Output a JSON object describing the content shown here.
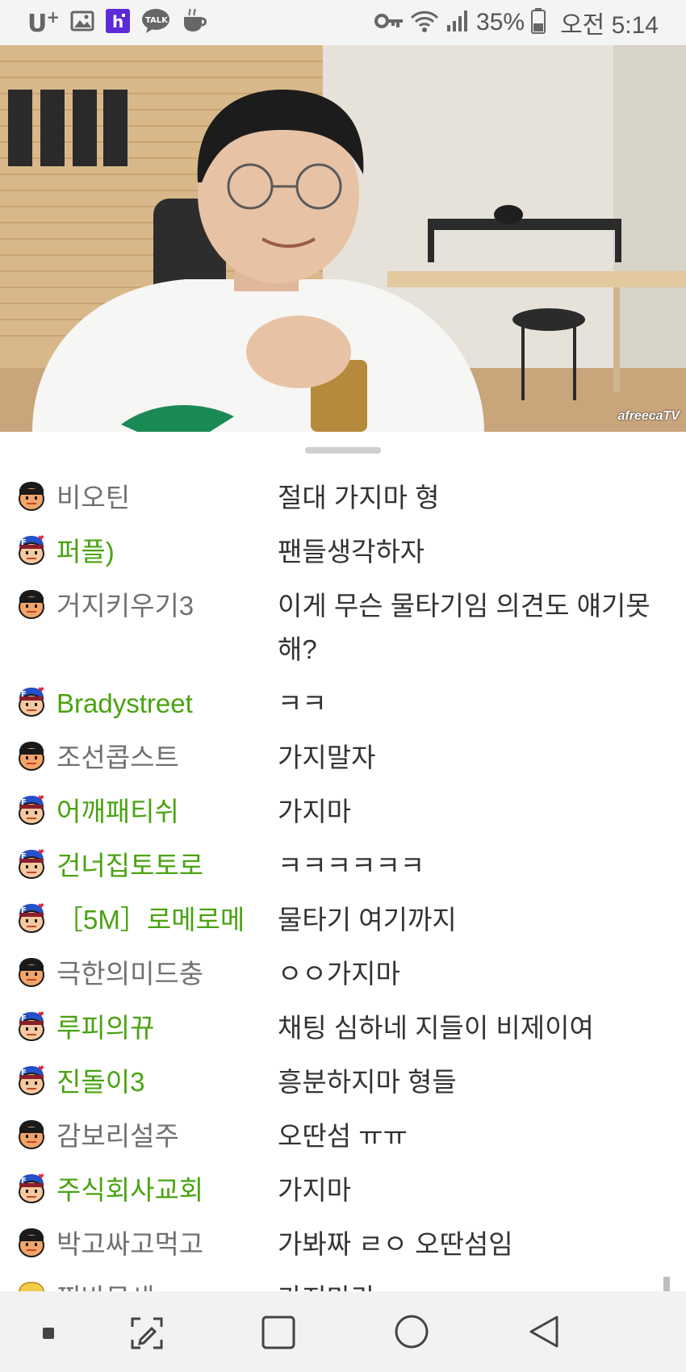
{
  "status_bar": {
    "carrier": "U",
    "carrier_sup": "+",
    "talk_label": "TALK",
    "battery": "35%",
    "time": "오전 5:14",
    "icons": [
      "image-icon",
      "h-app-icon",
      "kakaotalk-icon",
      "coffee-icon",
      "key-icon",
      "wifi-icon",
      "signal-icon",
      "battery-icon"
    ]
  },
  "video": {
    "watermark": "afreecaTV"
  },
  "chat": {
    "messages": [
      {
        "nick": "비오틴",
        "text": "절대 가지마 형",
        "fan": false,
        "badge": "regular"
      },
      {
        "nick": "퍼플)",
        "text": "팬들생각하자",
        "fan": true,
        "badge": "fan"
      },
      {
        "nick": "거지키우기3",
        "text": "이게 무슨 물타기임 의견도 얘기못해?",
        "fan": false,
        "badge": "regular"
      },
      {
        "nick": "Bradystreet",
        "text": "ㅋㅋ",
        "fan": true,
        "badge": "fan"
      },
      {
        "nick": "조선콥스트",
        "text": "가지말자",
        "fan": false,
        "badge": "regular"
      },
      {
        "nick": "어깨패티쉬",
        "text": "가지마",
        "fan": true,
        "badge": "fan"
      },
      {
        "nick": "건너집토토로",
        "text": "ㅋㅋㅋㅋㅋㅋ",
        "fan": true,
        "badge": "fan"
      },
      {
        "nick": "［5M］로메로메",
        "text": "물타기 여기까지",
        "fan": true,
        "badge": "fan"
      },
      {
        "nick": "극한의미드충",
        "text": "ㅇㅇ가지마",
        "fan": false,
        "badge": "regular"
      },
      {
        "nick": "루피의뀨",
        "text": "채팅 심하네 지들이 비제이여",
        "fan": true,
        "badge": "fan"
      },
      {
        "nick": "진돌이3",
        "text": "흥분하지마 형들",
        "fan": true,
        "badge": "fan"
      },
      {
        "nick": "감보리설주",
        "text": "오딴섬 ㅠㅠ",
        "fan": false,
        "badge": "regular"
      },
      {
        "nick": "주식회사교회",
        "text": "가지마",
        "fan": true,
        "badge": "fan"
      },
      {
        "nick": "박고싸고먹고",
        "text": "가봐짜 ㄹㅇ 오딴섬임",
        "fan": false,
        "badge": "regular"
      },
      {
        "nick": "찐반무새",
        "text": "가지마라",
        "fan": false,
        "badge": "blonde"
      }
    ]
  },
  "nav_bar": {
    "buttons": [
      "recent-apps-dot",
      "screen-capture",
      "overview",
      "home",
      "back"
    ]
  },
  "colors": {
    "fan_nick": "#49a310",
    "regular_nick": "#707070",
    "message_text": "#333333"
  }
}
